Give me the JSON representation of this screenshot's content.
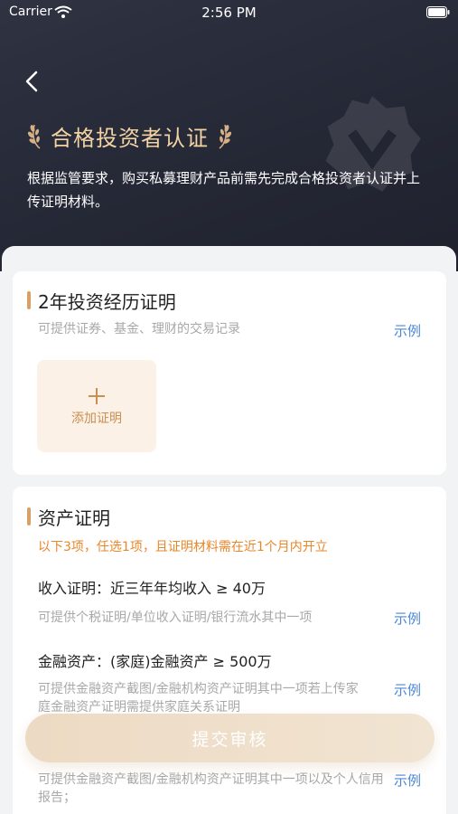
{
  "status": {
    "carrier": "Carrier",
    "time": "2:56 PM"
  },
  "header": {
    "title": "合格投资者认证",
    "desc": "根据监管要求，购买私募理财产品前需先完成合格投资者认证并上传证明材料。"
  },
  "card_experience": {
    "title": "2年投资经历证明",
    "hint": "可提供证券、基金、理财的交易记录",
    "example": "示例",
    "add_label": "添加证明"
  },
  "card_assets": {
    "title": "资产证明",
    "notice": "以下3项，任选1项，且证明材料需在近1个月内开立",
    "items": [
      {
        "title": "收入证明：近三年年均收入 ≥ 40万",
        "hint": "可提供个税证明/单位收入证明/银行流水其中一项",
        "example": "示例"
      },
      {
        "title": "金融资产：(家庭)金融资产 ≥ 500万",
        "hint": "可提供金融资产截图/金融机构资产证明其中一项若上传家庭金融资产证明需提供家庭关系证明",
        "example": "示例"
      },
      {
        "title": "",
        "hint": "可提供金融资产截图/金融机构资产证明其中一项以及个人信用报告；",
        "example": "示例"
      }
    ]
  },
  "submit": {
    "label": "提交审核"
  },
  "colors": {
    "accent": "#d9a066",
    "title_gold": "#f3d2a4",
    "link": "#4a86d8",
    "notice": "#e8872a"
  }
}
